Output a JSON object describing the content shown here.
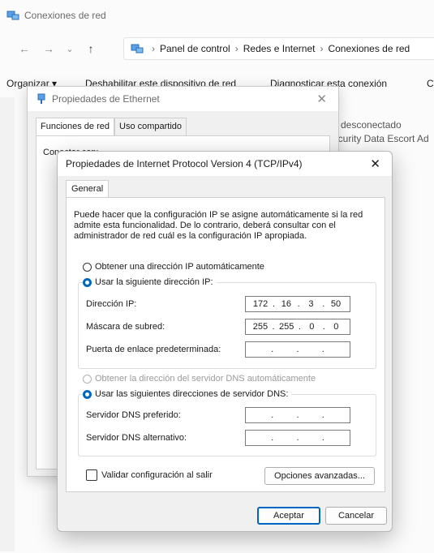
{
  "explorer": {
    "window_title": "Conexiones de red",
    "nav": {
      "back_icon": "arrow-left-icon",
      "forward_icon": "arrow-right-icon",
      "recent_icon": "chevron-down-icon",
      "up_icon": "arrow-up-icon"
    },
    "breadcrumb": [
      "Panel de control",
      "Redes e Internet",
      "Conexiones de red"
    ],
    "commands": [
      "Organizar ▾",
      "Deshabilitar este dispositivo de red",
      "Diagnosticar esta conexión",
      "C"
    ],
    "status_lines": [
      "d desconectado",
      "ecurity Data Escort Ad"
    ]
  },
  "ethernet_dialog": {
    "title": "Propiedades de Ethernet",
    "tabs": [
      "Funciones de red",
      "Uso compartido"
    ],
    "connect_label": "Conectar con:"
  },
  "ipv4_dialog": {
    "title": "Propiedades de Internet Protocol Version 4 (TCP/IPv4)",
    "tab": "General",
    "description": "Puede hacer que la configuración IP se asigne automáticamente si la red admite esta funcionalidad. De lo contrario, deberá consultar con el administrador de red cuál es la configuración IP apropiada.",
    "ip_auto_label": "Obtener una dirección IP automáticamente",
    "ip_manual_label": "Usar la siguiente dirección IP:",
    "ip_address_label": "Dirección IP:",
    "ip_address": [
      "172",
      "16",
      "3",
      "50"
    ],
    "subnet_label": "Máscara de subred:",
    "subnet": [
      "255",
      "255",
      "0",
      "0"
    ],
    "gateway_label": "Puerta de enlace predeterminada:",
    "dns_auto_label": "Obtener la dirección del servidor DNS automáticamente",
    "dns_manual_label": "Usar las siguientes direcciones de servidor DNS:",
    "dns_preferred_label": "Servidor DNS preferido:",
    "dns_alternate_label": "Servidor DNS alternativo:",
    "validate_label": "Validar configuración al salir",
    "advanced_button": "Opciones avanzadas...",
    "ok_button": "Aceptar",
    "cancel_button": "Cancelar",
    "selected_ip_mode": "manual",
    "selected_dns_mode": "manual",
    "validate_checked": false,
    "accent_color": "#0067c0"
  }
}
